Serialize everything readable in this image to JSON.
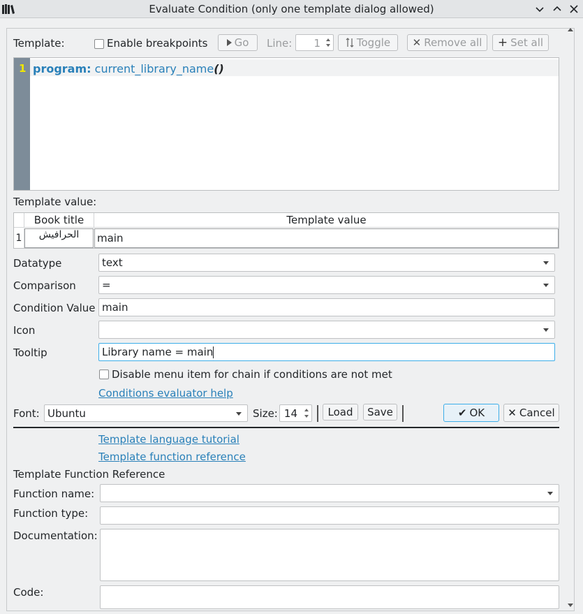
{
  "window": {
    "title": "Evaluate Condition (only one template dialog allowed)"
  },
  "toolbar": {
    "template_label": "Template:",
    "enable_breakpoints": "Enable breakpoints",
    "go": "Go",
    "line_label": "Line:",
    "line_value": "1",
    "toggle": "Toggle",
    "remove_all": "Remove all",
    "set_all": "Set all"
  },
  "editor": {
    "line_number": "1",
    "keyword": "program:",
    "function": "current_library_name",
    "parens": "()"
  },
  "template_value": {
    "label": "Template value:",
    "columns": [
      "Book title",
      "Template value"
    ],
    "rows": [
      {
        "num": "1",
        "title": "الحرافيش",
        "value": "main"
      }
    ]
  },
  "form": {
    "datatype_label": "Datatype",
    "datatype_value": "text",
    "comparison_label": "Comparison",
    "comparison_value": "=",
    "condition_value_label": "Condition Value",
    "condition_value": "main",
    "icon_label": "Icon",
    "icon_value": "",
    "tooltip_label": "Tooltip",
    "tooltip_value": "Library name = main",
    "disable_menu_label": "Disable menu item for chain if conditions are not met",
    "help_link": "Conditions evaluator help"
  },
  "font_row": {
    "font_label": "Font:",
    "font_value": "Ubuntu",
    "size_label": "Size:",
    "size_value": "14",
    "load": "Load",
    "save": "Save",
    "ok": "OK",
    "cancel": "Cancel"
  },
  "links": {
    "tutorial": "Template language tutorial",
    "reference": "Template function reference"
  },
  "function_ref": {
    "heading": "Template Function Reference",
    "function_name_label": "Function name:",
    "function_type_label": "Function type:",
    "documentation_label": "Documentation:",
    "code_label": "Code:"
  }
}
